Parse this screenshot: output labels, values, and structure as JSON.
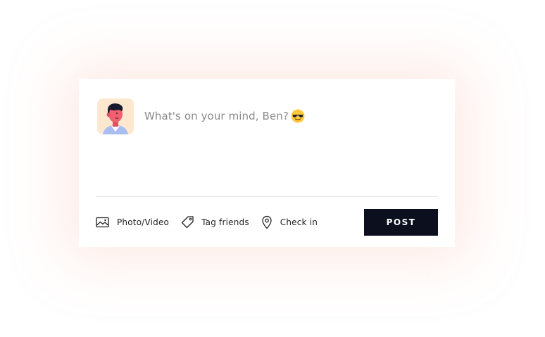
{
  "composer": {
    "placeholder": "What's on your mind, Ben?",
    "emoji": "smiling-face-with-sunglasses"
  },
  "actions": [
    {
      "label": "Photo/Video",
      "icon": "image-icon"
    },
    {
      "label": "Tag friends",
      "icon": "tag-icon"
    },
    {
      "label": "Check in",
      "icon": "location-pin-icon"
    }
  ],
  "post_button": {
    "label": "POST"
  },
  "colors": {
    "post_button_bg": "#0b0f1e",
    "avatar_bg": "#fde8cf",
    "glow": "#fdb2a0",
    "placeholder_text": "#8a8a8a"
  }
}
